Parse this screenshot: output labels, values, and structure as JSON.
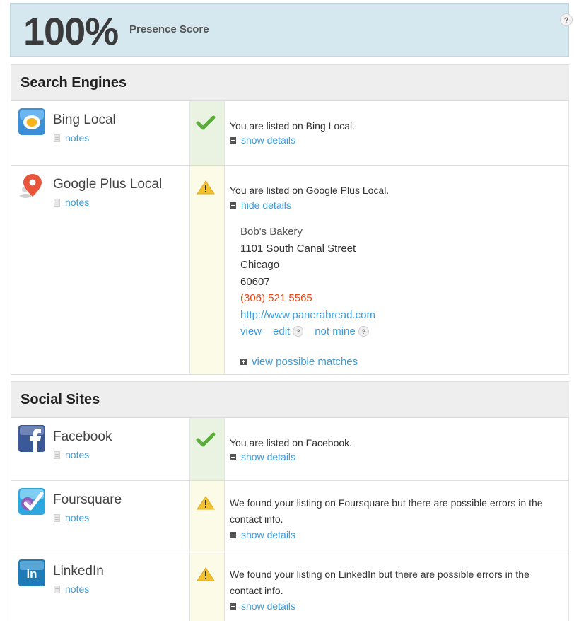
{
  "score": {
    "value": "100%",
    "label": "Presence Score",
    "help_symbol": "?"
  },
  "sections": {
    "search_engines": {
      "title": "Search Engines",
      "bing": {
        "name": "Bing Local",
        "notes": "notes",
        "status": "ok",
        "message": "You are listed on Bing Local.",
        "toggle": "show details"
      },
      "google": {
        "name": "Google Plus Local",
        "notes": "notes",
        "status": "warning",
        "message": "You are listed on Google Plus Local.",
        "toggle": "hide details",
        "details": {
          "business_name": "Bob's Bakery",
          "street": "1101 South Canal Street",
          "city": "Chicago",
          "zip": "60607",
          "phone": "(306) 521 5565",
          "url": "http://www.panerabread.com",
          "action_view": "view",
          "action_edit": "edit",
          "action_not_mine": "not mine",
          "help_symbol": "?",
          "possible_matches": "view possible matches"
        }
      }
    },
    "social_sites": {
      "title": "Social Sites",
      "facebook": {
        "name": "Facebook",
        "notes": "notes",
        "status": "ok",
        "message": "You are listed on Facebook.",
        "toggle": "show details"
      },
      "foursquare": {
        "name": "Foursquare",
        "notes": "notes",
        "status": "warning",
        "message": "We found your listing on Foursquare but there are possible errors in the contact info.",
        "toggle": "show details"
      },
      "linkedin": {
        "name": "LinkedIn",
        "notes": "notes",
        "status": "warning",
        "message": "We found your listing on LinkedIn but there are possible errors in the contact info.",
        "toggle": "show details",
        "logo_text": "in"
      }
    }
  },
  "colors": {
    "link": "#3b9ddc",
    "phone": "#e64a19",
    "ok_check": "#5aaa3c",
    "warning": "#f2c12e",
    "header_bg": "#d5e7ef"
  },
  "icons": {
    "bing": "bing-logo-icon",
    "google": "map-pin-icon",
    "facebook": "facebook-logo-icon",
    "foursquare": "foursquare-logo-icon",
    "linkedin": "linkedin-logo-icon",
    "ok": "checkmark-icon",
    "warning": "warning-triangle-icon",
    "notes": "document-icon"
  }
}
